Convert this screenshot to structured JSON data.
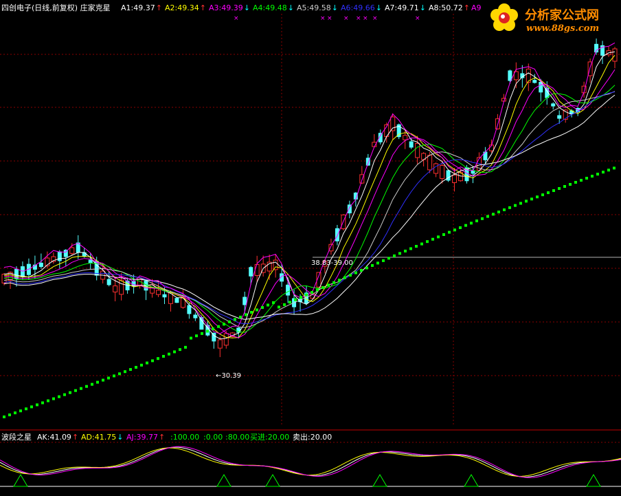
{
  "main": {
    "title": "四创电子(日线,前复权)  庄家克星",
    "indicators": [
      {
        "label": "A1:49.37",
        "arrow": "↑",
        "color": "#ffffff",
        "arrowColor": "#ff3030"
      },
      {
        "label": "A2:49.34",
        "arrow": "↑",
        "color": "#ffff00",
        "arrowColor": "#ff3030"
      },
      {
        "label": "A3:49.39",
        "arrow": "↓",
        "color": "#ff00ff",
        "arrowColor": "#00ffff"
      },
      {
        "label": "A4:49.48",
        "arrow": "↓",
        "color": "#00ff00",
        "arrowColor": "#00ffff"
      },
      {
        "label": "A5:49.58",
        "arrow": "↓",
        "color": "#cccccc",
        "arrowColor": "#00ffff"
      },
      {
        "label": "A6:49.66",
        "arrow": "↓",
        "color": "#3030ff",
        "arrowColor": "#00ffff"
      },
      {
        "label": "A7:49.71",
        "arrow": "↓",
        "color": "#ffffff",
        "arrowColor": "#00ffff"
      },
      {
        "label": "A8:50.72",
        "arrow": "↑",
        "color": "#ffffff",
        "arrowColor": "#ff3030"
      },
      {
        "label": "A9",
        "arrow": "",
        "color": "#ff00ff",
        "arrowColor": "#ff00ff"
      }
    ],
    "price_high_label": "38.83-39.00",
    "price_low_label": "←30.39"
  },
  "logo": {
    "title": "分析家公式网",
    "url": "www.88gs.com"
  },
  "sub": {
    "name": "波段之星",
    "items": [
      {
        "label": "AK:41.09",
        "arrow": "↑",
        "color": "#ffffff",
        "arrowColor": "#ff3030"
      },
      {
        "label": "AD:41.75",
        "arrow": "↓",
        "color": "#ffff00",
        "arrowColor": "#00ffff"
      },
      {
        "label": "AJ:39.77",
        "arrow": "↑",
        "color": "#ff00ff",
        "arrowColor": "#ff3030"
      },
      {
        "label": ":100.00",
        "arrow": "",
        "color": "#00ff00"
      },
      {
        "label": ":0.00",
        "arrow": "",
        "color": "#00ff00"
      },
      {
        "label": ":80.00",
        "arrow": "",
        "color": "#00ff00"
      },
      {
        "label": "买进:20.00",
        "arrow": "",
        "color": "#00ff00"
      },
      {
        "label": "卖出:20.00",
        "arrow": "",
        "color": "#ffffff"
      }
    ]
  },
  "colors": {
    "up": "#ff3030",
    "down": "#54ffff",
    "dots": "#00ff00",
    "grid": "#8b0000",
    "bg": "#000000"
  }
}
